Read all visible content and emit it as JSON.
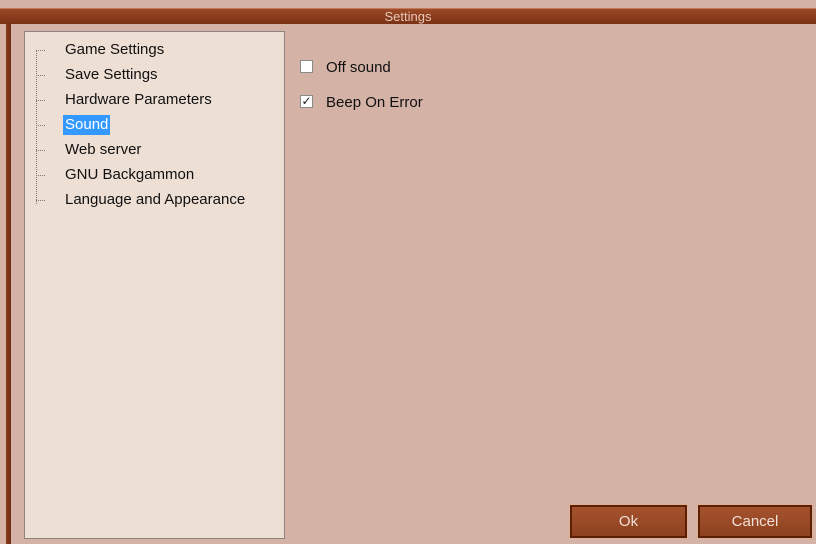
{
  "window": {
    "title": "Settings"
  },
  "tree": {
    "items": [
      {
        "label": "Game Settings",
        "selected": false
      },
      {
        "label": "Save Settings",
        "selected": false
      },
      {
        "label": "Hardware Parameters",
        "selected": false
      },
      {
        "label": "Sound",
        "selected": true
      },
      {
        "label": "Web server",
        "selected": false
      },
      {
        "label": "GNU Backgammon",
        "selected": false
      },
      {
        "label": "Language and Appearance",
        "selected": false
      }
    ]
  },
  "sound_settings": {
    "off_sound": {
      "label": "Off sound",
      "checked": false
    },
    "beep_on_error": {
      "label": "Beep On Error",
      "checked": true
    }
  },
  "buttons": {
    "ok_label": "Ok",
    "cancel_label": "Cancel"
  },
  "colors": {
    "background": "#d4b2a5",
    "titlebar": "#8a3c1d",
    "selection": "#3399ff",
    "tree_panel": "#eedfd5"
  }
}
